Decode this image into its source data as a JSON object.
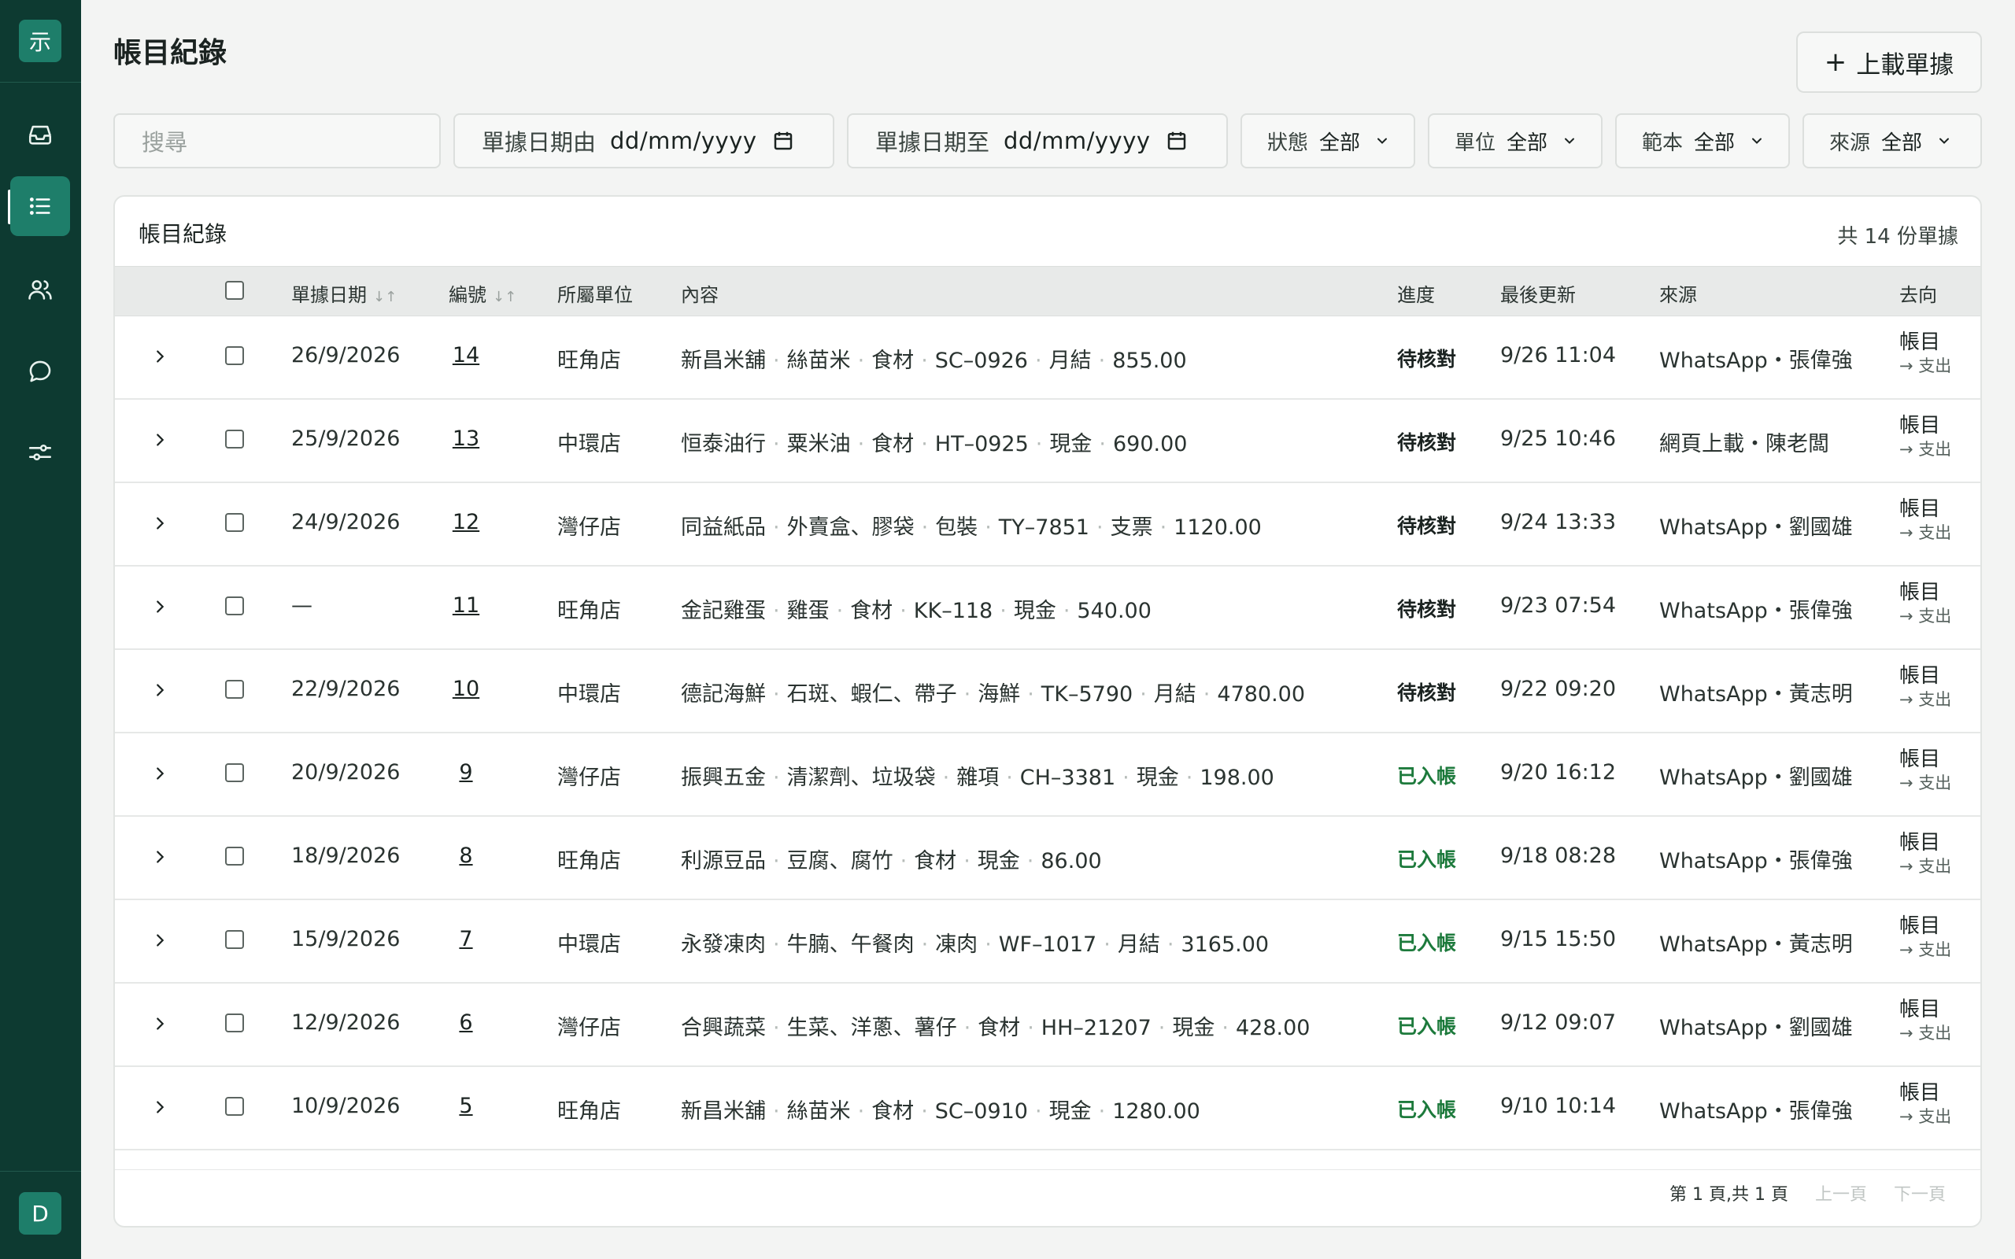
{
  "sidebar": {
    "logo": "示",
    "nav": [
      "inbox-icon",
      "list-icon",
      "users-icon",
      "chat-icon",
      "sliders-icon"
    ],
    "avatar": "D",
    "accent": "#1e7e6a",
    "background": "#0d3a31"
  },
  "header": {
    "title": "帳目紀錄",
    "upload_label": "上載單據",
    "upload_icon": "+"
  },
  "filters": {
    "search_placeholder": "搜尋",
    "date_from_label": "單據日期由",
    "date_from_value": "dd/mm/yyyy",
    "date_to_label": "單據日期至",
    "date_to_value": "dd/mm/yyyy",
    "status_label": "狀態",
    "status_value": "全部",
    "unit_label": "單位",
    "unit_value": "全部",
    "template_label": "範本",
    "template_value": "全部",
    "source_label": "來源",
    "source_value": "全部"
  },
  "table": {
    "title": "帳目紀錄",
    "count": "共 14 份單據",
    "columns": {
      "date": "單據日期",
      "id": "編號",
      "unit": "所屬單位",
      "content": "內容",
      "progress": "進度",
      "updated": "最後更新",
      "source": "來源",
      "dest": "去向"
    },
    "rows": [
      {
        "date": "26/9/2026",
        "id": "14",
        "unit": "旺角店",
        "content": [
          "新昌米舖",
          "絲苗米",
          "食材",
          "SC–0926",
          "月結",
          "855.00"
        ],
        "status": "待核對",
        "status_type": "pending",
        "updated": "9/26 11:04",
        "source": "WhatsApp・張偉強",
        "dest1": "帳目",
        "dest2": "→ 支出"
      },
      {
        "date": "25/9/2026",
        "id": "13",
        "unit": "中環店",
        "content": [
          "恒泰油行",
          "粟米油",
          "食材",
          "HT–0925",
          "現金",
          "690.00"
        ],
        "status": "待核對",
        "status_type": "pending",
        "updated": "9/25 10:46",
        "source": "網頁上載・陳老闆",
        "dest1": "帳目",
        "dest2": "→ 支出"
      },
      {
        "date": "24/9/2026",
        "id": "12",
        "unit": "灣仔店",
        "content": [
          "同益紙品",
          "外賣盒、膠袋",
          "包裝",
          "TY–7851",
          "支票",
          "1120.00"
        ],
        "status": "待核對",
        "status_type": "pending",
        "updated": "9/24 13:33",
        "source": "WhatsApp・劉國雄",
        "dest1": "帳目",
        "dest2": "→ 支出"
      },
      {
        "date": "—",
        "id": "11",
        "unit": "旺角店",
        "content": [
          "金記雞蛋",
          "雞蛋",
          "食材",
          "KK–118",
          "現金",
          "540.00"
        ],
        "status": "待核對",
        "status_type": "pending",
        "updated": "9/23 07:54",
        "source": "WhatsApp・張偉強",
        "dest1": "帳目",
        "dest2": "→ 支出"
      },
      {
        "date": "22/9/2026",
        "id": "10",
        "unit": "中環店",
        "content": [
          "德記海鮮",
          "石斑、蝦仁、帶子",
          "海鮮",
          "TK–5790",
          "月結",
          "4780.00"
        ],
        "status": "待核對",
        "status_type": "pending",
        "updated": "9/22 09:20",
        "source": "WhatsApp・黃志明",
        "dest1": "帳目",
        "dest2": "→ 支出"
      },
      {
        "date": "20/9/2026",
        "id": "9",
        "unit": "灣仔店",
        "content": [
          "振興五金",
          "清潔劑、垃圾袋",
          "雜項",
          "CH–3381",
          "現金",
          "198.00"
        ],
        "status": "已入帳",
        "status_type": "done",
        "updated": "9/20 16:12",
        "source": "WhatsApp・劉國雄",
        "dest1": "帳目",
        "dest2": "→ 支出"
      },
      {
        "date": "18/9/2026",
        "id": "8",
        "unit": "旺角店",
        "content": [
          "利源豆品",
          "豆腐、腐竹",
          "食材",
          "現金",
          "86.00"
        ],
        "status": "已入帳",
        "status_type": "done",
        "updated": "9/18 08:28",
        "source": "WhatsApp・張偉強",
        "dest1": "帳目",
        "dest2": "→ 支出"
      },
      {
        "date": "15/9/2026",
        "id": "7",
        "unit": "中環店",
        "content": [
          "永發凍肉",
          "牛腩、午餐肉",
          "凍肉",
          "WF–1017",
          "月結",
          "3165.00"
        ],
        "status": "已入帳",
        "status_type": "done",
        "updated": "9/15 15:50",
        "source": "WhatsApp・黃志明",
        "dest1": "帳目",
        "dest2": "→ 支出"
      },
      {
        "date": "12/9/2026",
        "id": "6",
        "unit": "灣仔店",
        "content": [
          "合興蔬菜",
          "生菜、洋蔥、薯仔",
          "食材",
          "HH–21207",
          "現金",
          "428.00"
        ],
        "status": "已入帳",
        "status_type": "done",
        "updated": "9/12 09:07",
        "source": "WhatsApp・劉國雄",
        "dest1": "帳目",
        "dest2": "→ 支出"
      },
      {
        "date": "10/9/2026",
        "id": "5",
        "unit": "旺角店",
        "content": [
          "新昌米舖",
          "絲苗米",
          "食材",
          "SC–0910",
          "現金",
          "1280.00"
        ],
        "status": "已入帳",
        "status_type": "done",
        "updated": "9/10 10:14",
        "source": "WhatsApp・張偉強",
        "dest1": "帳目",
        "dest2": "→ 支出"
      }
    ],
    "pager": {
      "info": "第 1 頁,共 1 頁",
      "prev": "上一頁",
      "next": "下一頁"
    }
  },
  "colors": {
    "pending": "#1b2321",
    "done": "#1d7a3c"
  }
}
